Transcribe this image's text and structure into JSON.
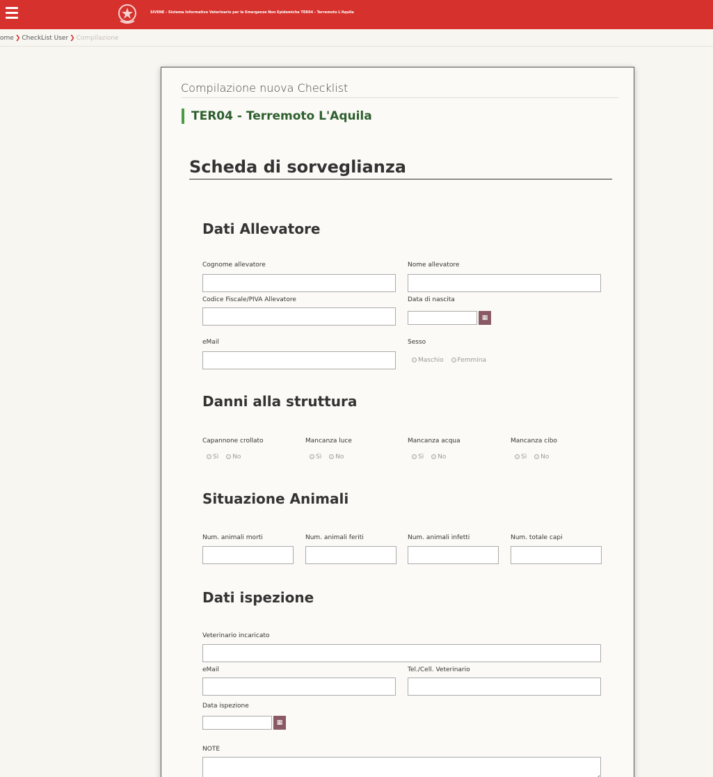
{
  "header": {
    "title": "SIVENE - Sistema Informativo Veterinario per le Emergenze Non Epidemiche    TER04 - Terremoto L'Aquila"
  },
  "breadcrumb": {
    "items": [
      "ome",
      "CheckList User",
      "Compilazione"
    ]
  },
  "card": {
    "header": "Compilazione nuova Checklist",
    "event_title": "TER04 - Terremoto L'Aquila",
    "form_title": "Scheda di sorveglianza"
  },
  "sections": {
    "allevatore": {
      "title": "Dati Allevatore",
      "cognome_label": "Cognome allevatore",
      "nome_label": "Nome allevatore",
      "codice_label": "Codice Fiscale/PIVA Allevatore",
      "data_nascita_label": "Data di nascita",
      "email_label": "eMail",
      "sesso_label": "Sesso",
      "sesso_options": [
        "Maschio",
        "Femmina"
      ]
    },
    "danni": {
      "title": "Danni alla struttura",
      "items": [
        {
          "label": "Capannone crollato",
          "options": [
            "Sì",
            "No"
          ]
        },
        {
          "label": "Mancanza luce",
          "options": [
            "Sì",
            "No"
          ]
        },
        {
          "label": "Mancanza acqua",
          "options": [
            "Sì",
            "No"
          ]
        },
        {
          "label": "Mancanza cibo",
          "options": [
            "Sì",
            "No"
          ]
        }
      ]
    },
    "animali": {
      "title": "Situazione Animali",
      "morti_label": "Num. animali morti",
      "feriti_label": "Num. animali feriti",
      "infetti_label": "Num. animali infetti",
      "totale_label": "Num. totale capi"
    },
    "ispezione": {
      "title": "Dati ispezione",
      "veterinario_label": "Veterinario incaricato",
      "email_label": "eMail",
      "tel_label": "Tel./Cell. Veterinario",
      "data_label": "Data ispezione",
      "note_label": "NOTE"
    }
  },
  "colors": {
    "topbar": "#d6312d",
    "accent_green": "#4a9b45",
    "date_button": "#8a5a64"
  }
}
